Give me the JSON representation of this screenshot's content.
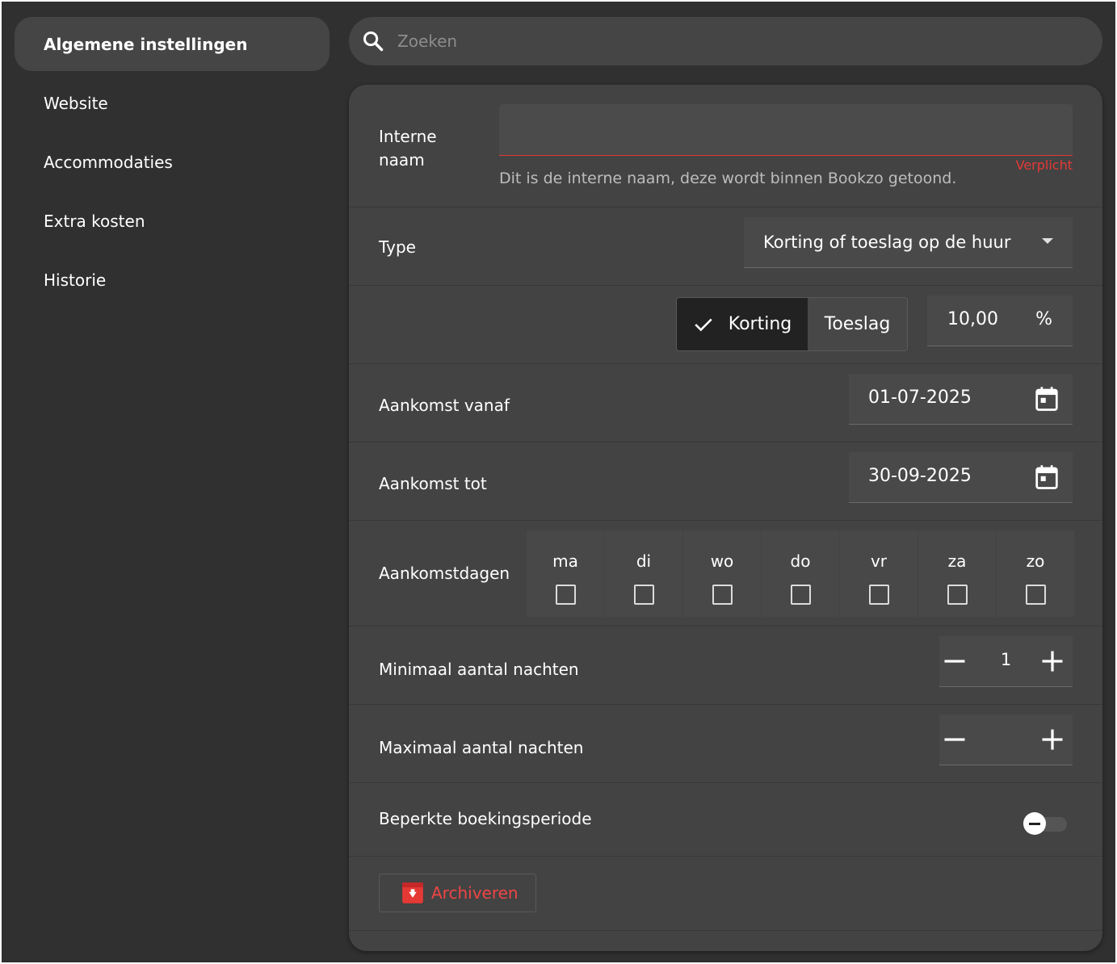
{
  "sidebar": {
    "items": [
      {
        "label": "Algemene instellingen",
        "active": true
      },
      {
        "label": "Website"
      },
      {
        "label": "Accommodaties"
      },
      {
        "label": "Extra kosten"
      },
      {
        "label": "Historie"
      }
    ]
  },
  "search": {
    "placeholder": "Zoeken",
    "icon": "search-icon"
  },
  "form": {
    "internal_name": {
      "label_line1": "Interne",
      "label_line2": "naam",
      "value": "",
      "required_text": "Verplicht",
      "hint": "Dit is de interne naam, deze wordt binnen Bookzo getoond."
    },
    "type": {
      "label": "Type",
      "selected": "Korting of toeslag op de huur"
    },
    "adjustment": {
      "options": [
        "Korting",
        "Toeslag"
      ],
      "selected": "Korting",
      "amount": "10,00",
      "unit": "%"
    },
    "arrival_from": {
      "label": "Aankomst vanaf",
      "value": "01-07-2025"
    },
    "arrival_to": {
      "label": "Aankomst tot",
      "value": "30-09-2025"
    },
    "arrival_days": {
      "label": "Aankomstdagen",
      "days": [
        "ma",
        "di",
        "wo",
        "do",
        "vr",
        "za",
        "zo"
      ]
    },
    "min_nights": {
      "label": "Minimaal aantal nachten",
      "value": "1"
    },
    "max_nights": {
      "label": "Maximaal aantal nachten",
      "value": ""
    },
    "limited_period": {
      "label": "Beperkte boekingsperiode",
      "enabled": false
    },
    "archive_button": "Archiveren"
  },
  "colors": {
    "accent": "#e53935",
    "background": "#303030",
    "card": "#434343"
  }
}
